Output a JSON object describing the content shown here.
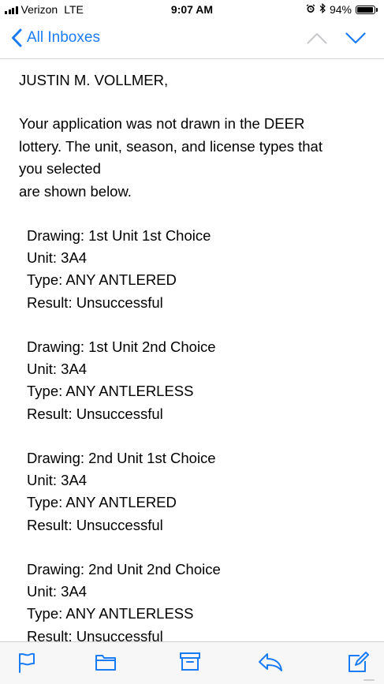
{
  "status_bar": {
    "carrier": "Verizon",
    "network": "LTE",
    "time": "9:07 AM",
    "battery_percent": "94%",
    "battery_level": 0.94
  },
  "nav": {
    "back_label": "All Inboxes"
  },
  "email": {
    "greeting": "JUSTIN M. VOLLMER,",
    "body_lines": [
      "Your application was not drawn in the DEER",
      "lottery. The unit, season, and license types that",
      "you selected",
      "are shown below."
    ],
    "drawings": [
      {
        "drawing": "Drawing: 1st Unit 1st Choice",
        "unit": "Unit: 3A4",
        "type": "Type: ANY ANTLERED",
        "result": "Result: Unsuccessful"
      },
      {
        "drawing": "Drawing: 1st Unit 2nd Choice",
        "unit": "Unit: 3A4",
        "type": "Type: ANY ANTLERLESS",
        "result": "Result: Unsuccessful"
      },
      {
        "drawing": "Drawing: 2nd Unit 1st Choice",
        "unit": "Unit: 3A4",
        "type": "Type: ANY ANTLERED",
        "result": "Result: Unsuccessful"
      },
      {
        "drawing": "Drawing: 2nd Unit 2nd Choice",
        "unit": "Unit: 3A4",
        "type": "Type: ANY ANTLERLESS",
        "result": "Result: Unsuccessful"
      }
    ]
  },
  "toolbar": {
    "icons": [
      "flag-icon",
      "folder-icon",
      "archive-icon",
      "reply-icon",
      "compose-icon"
    ]
  },
  "colors": {
    "accent": "#1a7cf5",
    "disabled": "#c7c7cc"
  }
}
